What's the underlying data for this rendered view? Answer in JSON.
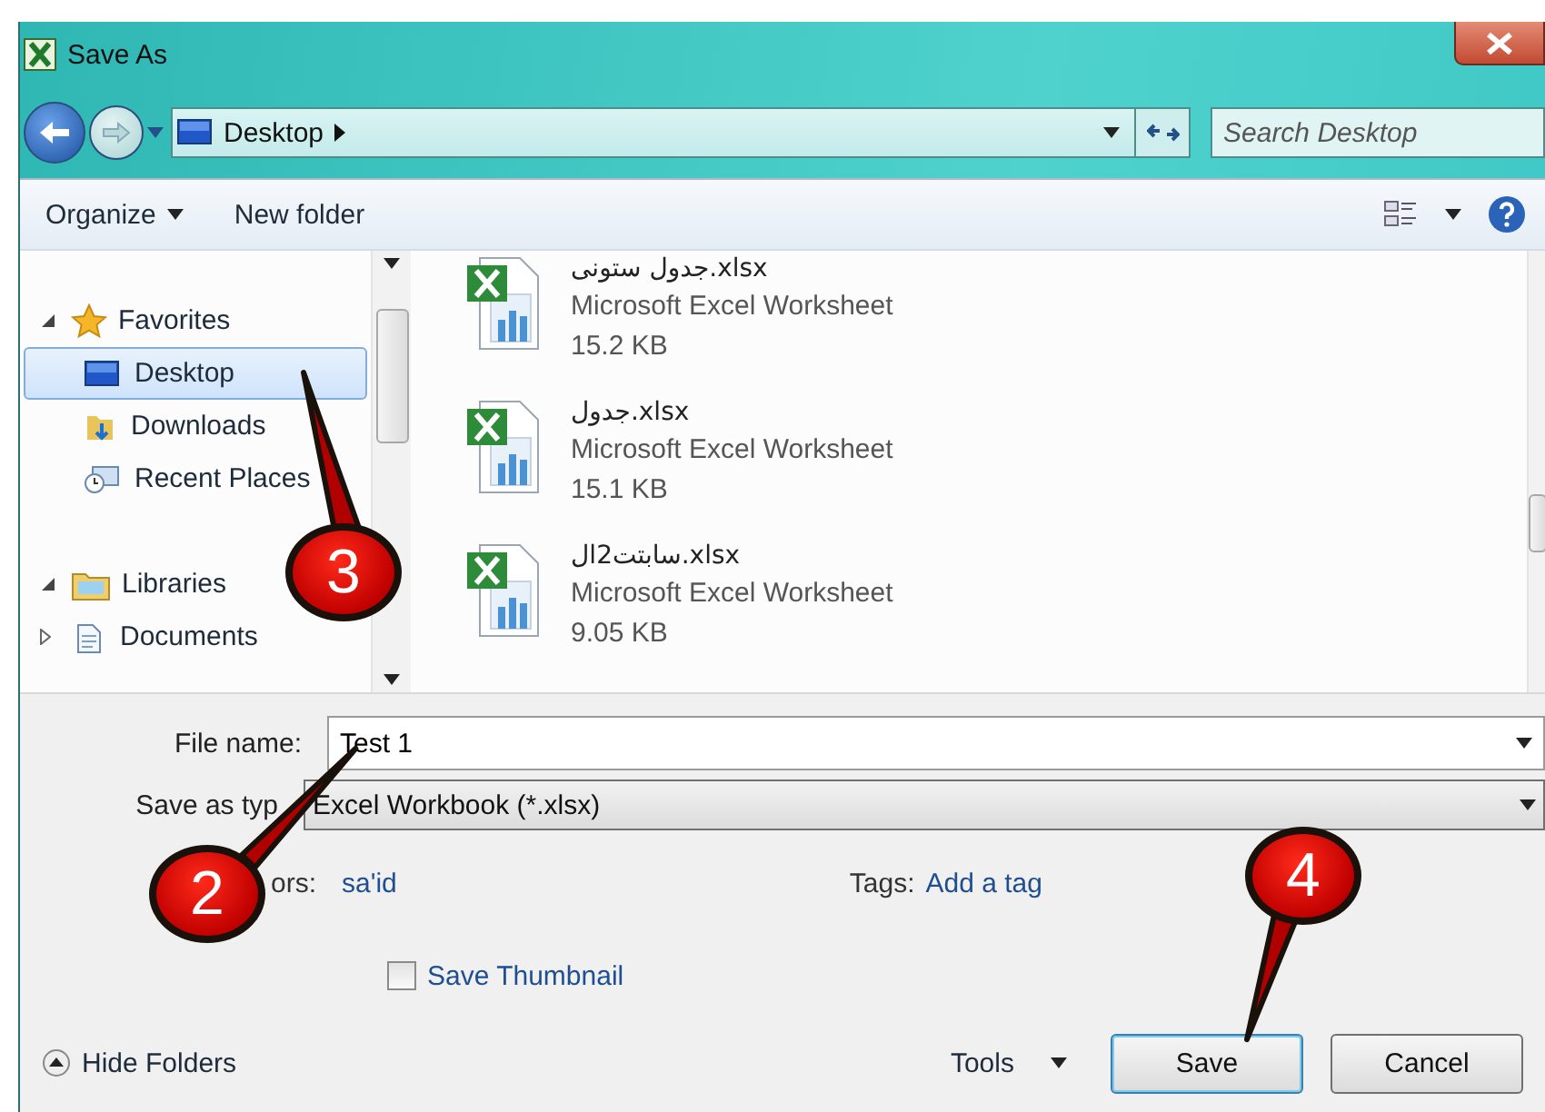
{
  "window": {
    "title": "Save As"
  },
  "navigation": {
    "address": "Desktop",
    "search": {
      "placeholder": "Search Desktop"
    }
  },
  "toolbar": {
    "organize": "Organize",
    "new_folder": "New folder"
  },
  "sidebar": {
    "groups": [
      {
        "label": "Favorites",
        "expanded": true,
        "children": [
          {
            "label": "Desktop",
            "selected": true
          },
          {
            "label": "Downloads",
            "selected": false
          },
          {
            "label": "Recent Places",
            "selected": false
          }
        ]
      },
      {
        "label": "Libraries",
        "expanded": true,
        "children": [
          {
            "label": "Documents",
            "selected": false,
            "expanded": false
          }
        ]
      }
    ]
  },
  "files": [
    {
      "name": "جدول ستونی.xlsx",
      "type": "Microsoft Excel Worksheet",
      "size": "15.2 KB"
    },
    {
      "name": "جدول.xlsx",
      "type": "Microsoft Excel Worksheet",
      "size": "15.1 KB"
    },
    {
      "name": "سابتت2ال.xlsx",
      "type": "Microsoft Excel Worksheet",
      "size": "9.05 KB"
    }
  ],
  "form": {
    "file_name": {
      "label": "File name:",
      "value": "Test 1"
    },
    "save_as_type": {
      "label": "Save as typ",
      "value": "Excel Workbook (*.xlsx)"
    },
    "authors": {
      "label": "ors:",
      "value": "sa'id"
    },
    "tags": {
      "label": "Tags:",
      "value": "Add a tag"
    },
    "save_thumbnail": {
      "label": "Save Thumbnail",
      "checked": false
    }
  },
  "footer": {
    "hide_folders": "Hide Folders",
    "tools": "Tools",
    "buttons": [
      "Save",
      "Cancel"
    ]
  },
  "callouts": [
    {
      "number": "3"
    },
    {
      "number": "2"
    },
    {
      "number": "4"
    }
  ]
}
